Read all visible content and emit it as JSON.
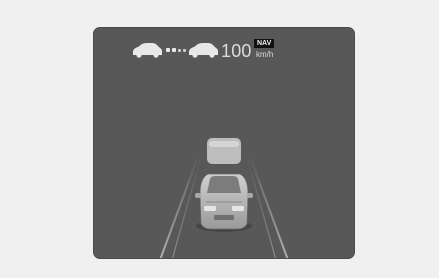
{
  "cruise": {
    "set_speed": "100",
    "mode_badge": "NAV",
    "unit": "km/h",
    "gap_icon": "following-distance-icon"
  },
  "scene": {
    "lead_vehicle_icon": "lead-vehicle-icon",
    "ego_vehicle_icon": "ego-vehicle-icon",
    "lane_lines_icon": "lane-lines-icon"
  }
}
